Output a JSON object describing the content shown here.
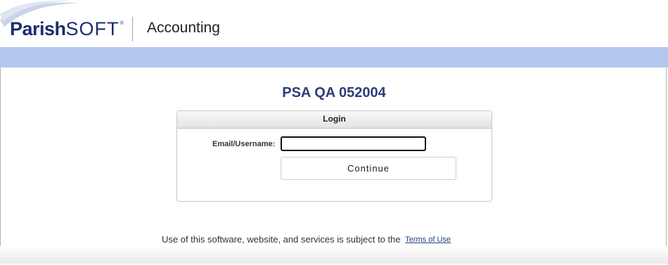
{
  "header": {
    "logo_parish": "Parish",
    "logo_soft": "SOFT",
    "logo_reg": "®",
    "app_title": "Accounting"
  },
  "main": {
    "org_title": "PSA QA 052004",
    "login_panel": {
      "title": "Login",
      "email_label": "Email/Username:",
      "email_value": "",
      "continue_label": "Continue"
    }
  },
  "footer": {
    "terms_text": "Use of this software, website, and services is subject to the",
    "terms_link": "Terms of Use"
  },
  "colors": {
    "brand_navy": "#1d2c6b",
    "band_blue": "#b3c8ee",
    "title_blue": "#2c3e7a"
  }
}
